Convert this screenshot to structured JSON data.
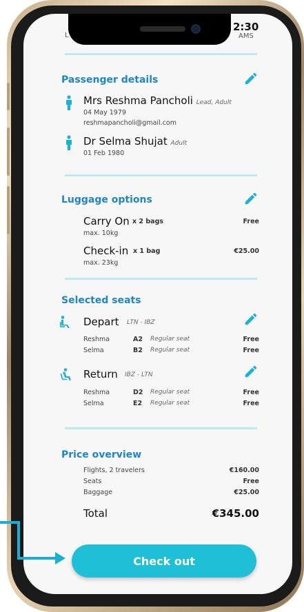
{
  "header": {
    "left_fragment": "L",
    "right_time": "2:30",
    "right_code": "AMS"
  },
  "passenger": {
    "title": "Passenger details",
    "people": [
      {
        "name": "Mrs Reshma Pancholi",
        "tag": "Lead, Adult",
        "dob": "04 May 1979",
        "email": "reshmapancholi@gmail.com"
      },
      {
        "name": "Dr Selma Shujat",
        "tag": "Adult",
        "dob": "01 Feb 1980"
      }
    ]
  },
  "luggage": {
    "title": "Luggage options",
    "items": [
      {
        "name": "Carry On",
        "count": "x 2 bags",
        "max": "max. 10kg",
        "price": "Free"
      },
      {
        "name": "Check-in",
        "count": "x 1 bag",
        "max": "max. 23kg",
        "price": "€25.00"
      }
    ]
  },
  "seats": {
    "title": "Selected seats",
    "legs": [
      {
        "label": "Depart",
        "route": "LTN - IBZ",
        "icon": "seat-icon",
        "rows": [
          {
            "name": "Reshma",
            "seat": "A2",
            "type": "Regular seat",
            "price": "Free"
          },
          {
            "name": "Selma",
            "seat": "B2",
            "type": "Regular seat",
            "price": "Free"
          }
        ]
      },
      {
        "label": "Return",
        "route": "IBZ - LTN",
        "icon": "reclined-seat-icon",
        "rows": [
          {
            "name": "Reshma",
            "seat": "D2",
            "type": "Regular seat",
            "price": "Free"
          },
          {
            "name": "Selma",
            "seat": "E2",
            "type": "Regular seat",
            "price": "Free"
          }
        ]
      }
    ]
  },
  "price": {
    "title": "Price overview",
    "lines": [
      {
        "label": "Flights, 2 travelers",
        "value": "€160.00"
      },
      {
        "label": "Seats",
        "value": "Free"
      },
      {
        "label": "Baggage",
        "value": "€25.00"
      }
    ],
    "total_label": "Total",
    "total_value": "€345.00"
  },
  "checkout_label": "Check out",
  "colors": {
    "accent": "#1e86c8",
    "button": "#1fbfd8",
    "divider": "#bfe8f0"
  }
}
